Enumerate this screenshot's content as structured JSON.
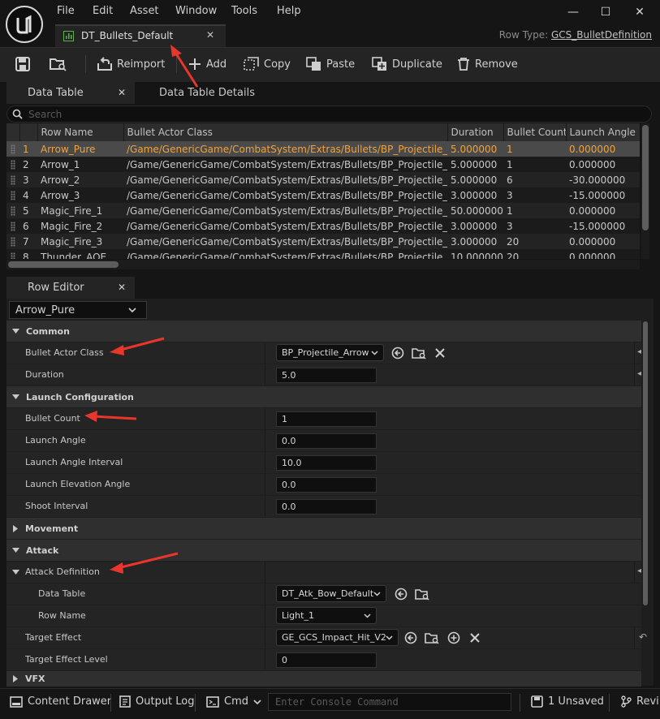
{
  "menu": [
    "File",
    "Edit",
    "Asset",
    "Window",
    "Tools",
    "Help"
  ],
  "document_tab": {
    "label": "DT_Bullets_Default"
  },
  "row_type": {
    "label": "Row Type:",
    "value": "GCS_BulletDefinition"
  },
  "toolbar": {
    "reimport": "Reimport",
    "add": "Add",
    "copy": "Copy",
    "paste": "Paste",
    "duplicate": "Duplicate",
    "remove": "Remove"
  },
  "panel_tabs": {
    "data_table": "Data Table",
    "data_table_details": "Data Table Details",
    "row_editor": "Row Editor"
  },
  "search": {
    "placeholder": "Search"
  },
  "table": {
    "columns": [
      "Row Name",
      "Bullet Actor Class",
      "Duration",
      "Bullet Count",
      "Launch Angle"
    ],
    "rows": [
      [
        "1",
        "Arrow_Pure",
        "/Game/GenericGame/CombatSystem/Extras/Bullets/BP_Projectile_Arrow",
        "5.000000",
        "1",
        "0.000000"
      ],
      [
        "2",
        "Arrow_1",
        "/Game/GenericGame/CombatSystem/Extras/Bullets/BP_Projectile_Arrow",
        "5.000000",
        "1",
        "0.000000"
      ],
      [
        "3",
        "Arrow_2",
        "/Game/GenericGame/CombatSystem/Extras/Bullets/BP_Projectile_Arrow",
        "5.000000",
        "6",
        "-30.000000"
      ],
      [
        "4",
        "Arrow_3",
        "/Game/GenericGame/CombatSystem/Extras/Bullets/BP_Projectile_Arrow",
        "3.000000",
        "3",
        "-15.000000"
      ],
      [
        "5",
        "Magic_Fire_1",
        "/Game/GenericGame/CombatSystem/Extras/Bullets/BP_Projectile_Ball.B",
        "50.000000",
        "1",
        "0.000000"
      ],
      [
        "6",
        "Magic_Fire_2",
        "/Game/GenericGame/CombatSystem/Extras/Bullets/BP_Projectile_Ball.B",
        "3.000000",
        "3",
        "-15.000000"
      ],
      [
        "7",
        "Magic_Fire_3",
        "/Game/GenericGame/CombatSystem/Extras/Bullets/BP_Projectile_Shield",
        "3.000000",
        "20",
        "0.000000"
      ],
      [
        "8",
        "Thunder_AOE",
        "/Game/GenericGame/CombatSystem/Extras/Bullets/BP_Projectile_Shield",
        "10.000000",
        "20",
        "0.000000"
      ]
    ],
    "selected_row": 0
  },
  "row_editor": {
    "selected_row": "Arrow_Pure",
    "categories": {
      "common": "Common",
      "launch": "Launch Configuration",
      "movement": "Movement",
      "attack": "Attack",
      "vfx": "VFX"
    },
    "props": {
      "bullet_actor_class": {
        "label": "Bullet Actor Class",
        "value": "BP_Projectile_Arrow"
      },
      "duration": {
        "label": "Duration",
        "value": "5.0"
      },
      "bullet_count": {
        "label": "Bullet Count",
        "value": "1"
      },
      "launch_angle": {
        "label": "Launch Angle",
        "value": "0.0"
      },
      "launch_angle_interval": {
        "label": "Launch Angle Interval",
        "value": "10.0"
      },
      "launch_elevation_angle": {
        "label": "Launch Elevation Angle",
        "value": "0.0"
      },
      "shoot_interval": {
        "label": "Shoot Interval",
        "value": "0.0"
      },
      "attack_definition": {
        "label": "Attack Definition"
      },
      "data_table": {
        "label": "Data Table",
        "value": "DT_Atk_Bow_Default"
      },
      "row_name": {
        "label": "Row Name",
        "value": "Light_1"
      },
      "target_effect": {
        "label": "Target Effect",
        "value": "GE_GCS_Impact_Hit_V2"
      },
      "target_effect_level": {
        "label": "Target Effect Level",
        "value": "0"
      }
    }
  },
  "statusbar": {
    "content_drawer": "Content Drawer",
    "output_log": "Output Log",
    "cmd": "Cmd",
    "console_placeholder": "Enter Console Command",
    "unsaved": "1 Unsaved",
    "revision": "Revi"
  },
  "colors": {
    "accent_selected": "#f2a23a",
    "annotation_arrow": "#e8362d"
  }
}
